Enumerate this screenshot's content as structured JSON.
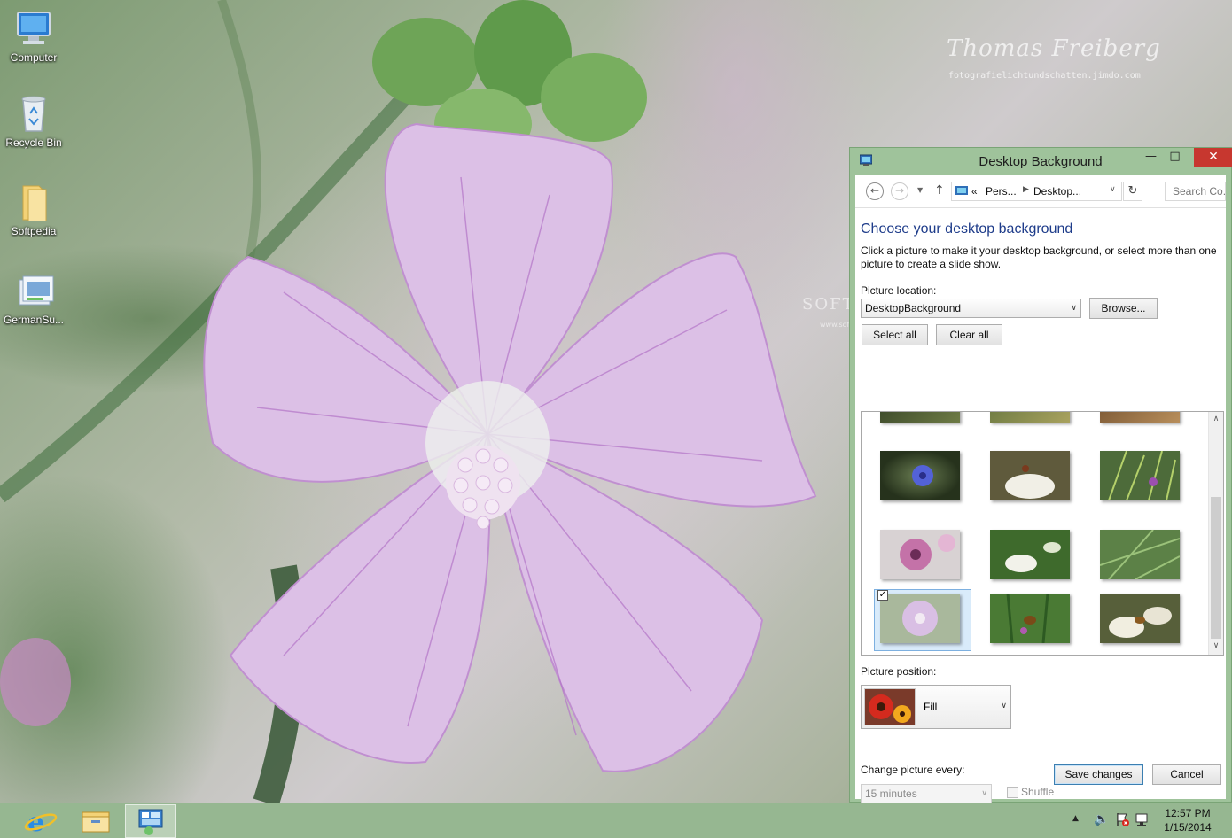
{
  "wallpaper": {
    "signature": "Thomas Freiberg",
    "url": "fotografielichtundschatten.jimdo.com",
    "softpedia_watermark": "SOFTPEDIA",
    "softpedia_url": "www.softpedia.com"
  },
  "desktop_icons": [
    {
      "label": "Computer",
      "icon": "computer-icon"
    },
    {
      "label": "Recycle Bin",
      "icon": "recycle-bin-icon"
    },
    {
      "label": "Softpedia",
      "icon": "folder-icon"
    },
    {
      "label": "GermanSu...",
      "icon": "theme-pack-icon"
    }
  ],
  "window": {
    "title": "Desktop Background",
    "breadcrumb": {
      "prefix": "«",
      "items": [
        "Pers...",
        "Desktop..."
      ]
    },
    "search_placeholder": "Search Co...",
    "heading": "Choose your desktop background",
    "description": "Click a picture to make it your desktop background, or select more than one picture to create a slide show.",
    "picture_location_label": "Picture location:",
    "picture_location_value": "DesktopBackground",
    "browse_label": "Browse...",
    "select_all_label": "Select all",
    "clear_all_label": "Clear all",
    "thumbnails": [
      {
        "subject": "blue-cornflower",
        "selected": false
      },
      {
        "subject": "white-yarrow-with-bug",
        "selected": false
      },
      {
        "subject": "green-grass-seeds",
        "selected": false
      },
      {
        "subject": "pink-flower-closeup",
        "selected": false
      },
      {
        "subject": "white-umbel-flower",
        "selected": false
      },
      {
        "subject": "green-foliage",
        "selected": false
      },
      {
        "subject": "pink-mallow-flower",
        "selected": true
      },
      {
        "subject": "bee-on-green",
        "selected": false
      },
      {
        "subject": "white-blossoms-with-bee",
        "selected": false
      }
    ],
    "picture_position_label": "Picture position:",
    "picture_position_value": "Fill",
    "change_picture_label": "Change picture every:",
    "change_picture_value": "15 minutes",
    "shuffle_label": "Shuffle",
    "save_label": "Save changes",
    "cancel_label": "Cancel",
    "colors": {
      "frame": "#9fc39b",
      "heading": "#1e3c8a",
      "close": "#c7372f"
    }
  },
  "taskbar": {
    "apps": [
      "internet-explorer-icon",
      "file-explorer-icon",
      "control-panel-icon"
    ],
    "active_app": "control-panel-icon",
    "time": "12:57 PM",
    "date": "1/15/2014"
  }
}
